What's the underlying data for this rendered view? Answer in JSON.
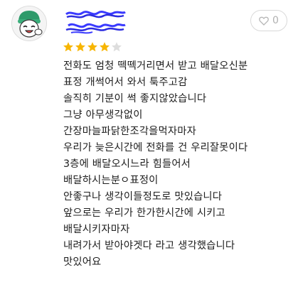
{
  "review": {
    "username": "■■■■■■■",
    "rating": 4,
    "rating_max": 5,
    "like_count": "0",
    "lines": [
      "전화도 엄청 떽떽거리면서 받고 배달오신분",
      "표정 개썩어서 와서 툭주고감",
      "솔직히 기분이 썩 좋지않았습니다",
      "그냥 아무생각없이",
      "간장마늘파닭한조각을먹자마자",
      "우리가 늦은시간에 전화를 건 우리잘못이다",
      "3층에 배달오시느라 힘들어서",
      "배달하시는분ㅇ표정이",
      "안좋구나 생각이들정도로 맛있습니다",
      "앞으로는 우리가 한가한시간에 시키고",
      "배달시키자마자",
      "내려가서 받아야겟다 라고 생각했습니다",
      "맛있어요"
    ]
  },
  "colors": {
    "star_filled": "#f7b500",
    "star_empty": "#dddddd",
    "redaction": "#3a3aff",
    "avatar_green": "#2e9a6a"
  },
  "icons": {
    "like": "heart-icon",
    "star": "star-icon",
    "avatar": "avatar-icon"
  }
}
